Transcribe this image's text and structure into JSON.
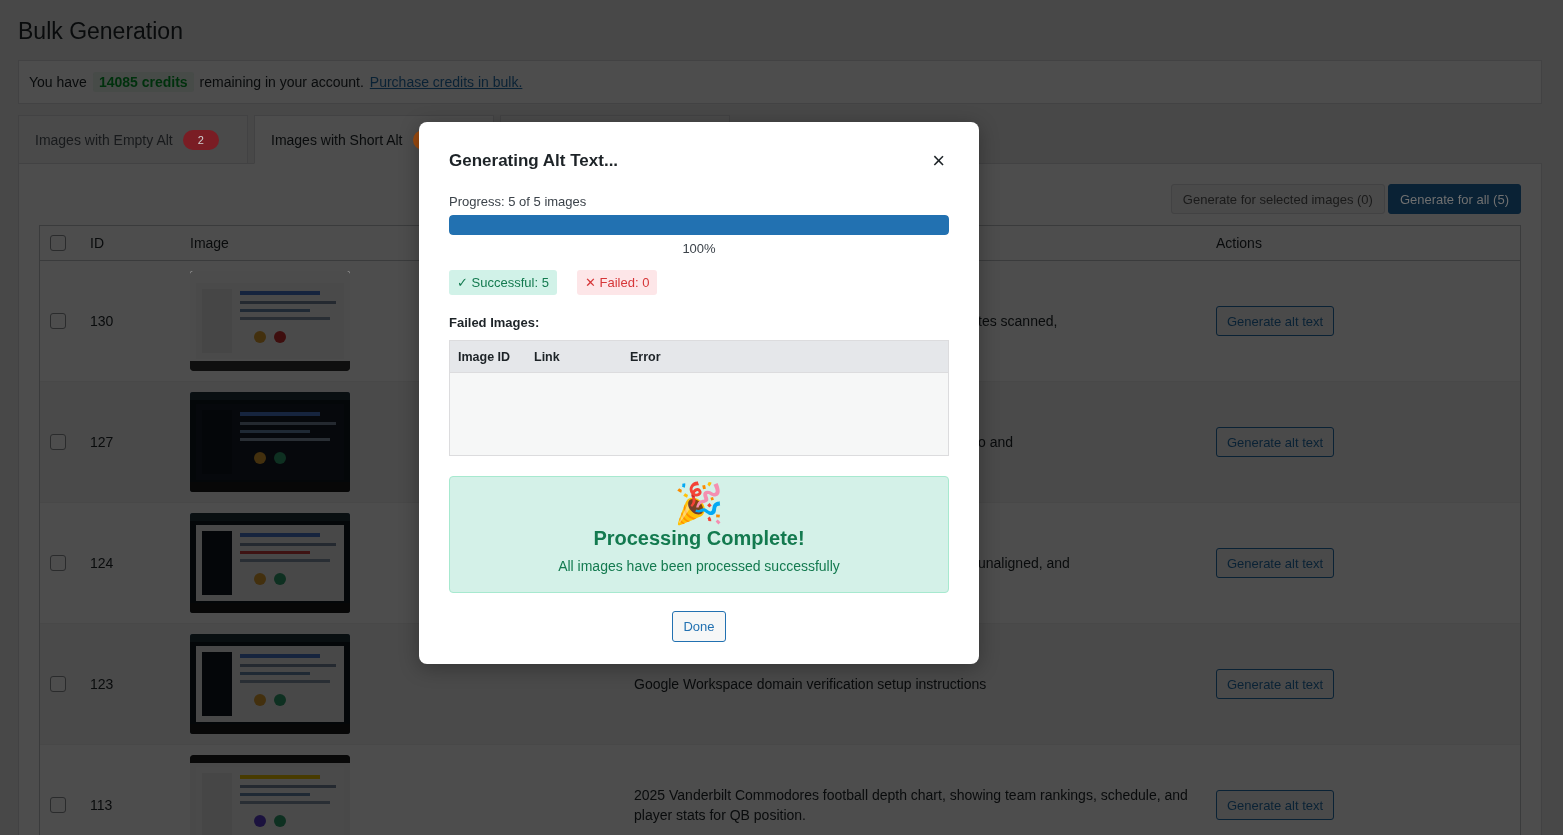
{
  "page_title": "Bulk Generation",
  "notice": {
    "before": "You have",
    "credits": "14085 credits",
    "after": "remaining in your account.",
    "link": "Purchase credits in bulk."
  },
  "tabs": [
    {
      "label": "Images with Empty Alt",
      "selected": false,
      "badge": {
        "count": "2",
        "color": "#7a1d24"
      }
    },
    {
      "label": "Images with Short Alt",
      "selected": true,
      "badge": {
        "color": "#9a4a10"
      }
    },
    {
      "selected": false
    }
  ],
  "actions": [
    {
      "label": "Generate for selected images (0)",
      "disabled": true
    },
    {
      "label": "Generate for all (5)",
      "disabled": false
    }
  ],
  "table": {
    "select_all_checked": false,
    "columns": [
      "ID",
      "Image",
      "Actions"
    ],
    "rows": [
      {
        "id": "130",
        "checked": false,
        "description": "tes scanned,",
        "clipped": true,
        "action": "Generate alt text"
      },
      {
        "id": "127",
        "checked": false,
        "description": "o and",
        "clipped": true,
        "action": "Generate alt text"
      },
      {
        "id": "124",
        "checked": false,
        "description": "unaligned, and",
        "clipped": true,
        "action": "Generate alt text"
      },
      {
        "id": "123",
        "checked": false,
        "description": "Google Workspace domain verification setup instructions",
        "clipped": false,
        "action": "Generate alt text"
      },
      {
        "id": "113",
        "checked": false,
        "description": "2025 Vanderbilt Commodores football depth chart, showing team rankings, schedule, and player stats for QB position.",
        "clipped": false,
        "action": "Generate alt text"
      }
    ]
  },
  "modal": {
    "title": "Generating Alt Text...",
    "close": "×",
    "progress_label": "Progress: 5 of 5 images",
    "level": 1,
    "percent": "100%",
    "stats": [
      {
        "kind": "success",
        "label": "✓ Successful: 5"
      },
      {
        "kind": "failure",
        "label": "✕ Failed: 0"
      }
    ],
    "failed_title": "Failed Images:",
    "failed_columns": [
      "Image ID",
      "Link",
      "Error"
    ],
    "complete": {
      "emoji": "🎉",
      "title": "Processing Complete!",
      "message": "All images have been processed successfully"
    },
    "done": "Done"
  }
}
